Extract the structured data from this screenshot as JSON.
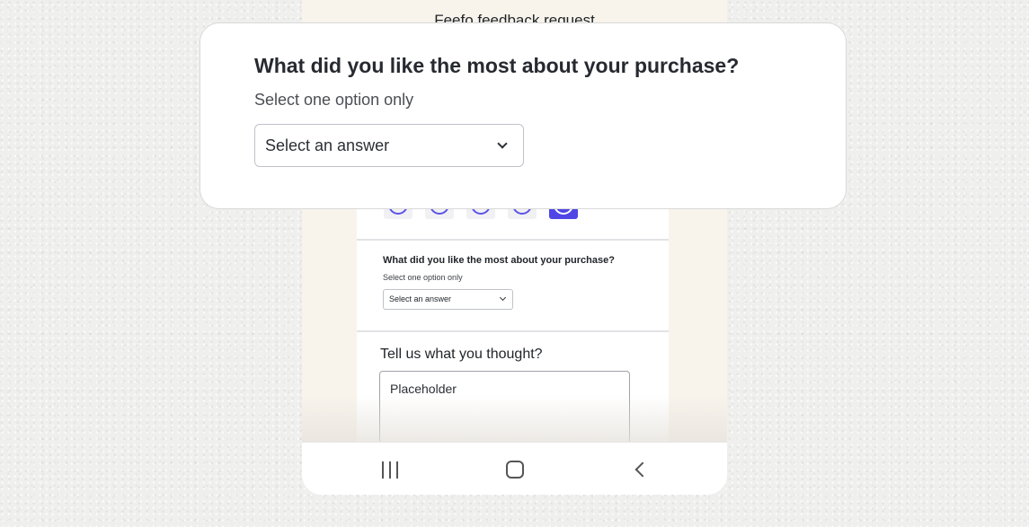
{
  "phone": {
    "title": "Feefo feedback request",
    "rating": {
      "selected_index": 4,
      "options": 5,
      "icon": "smiley-face-icon",
      "accent": "#4f46e5"
    },
    "mini_question": {
      "title": "What did you like the most about your purchase?",
      "subtitle": "Select one option only",
      "select_value": "Select an answer"
    },
    "comment": {
      "title": "Tell us what you thought?",
      "placeholder": "Placeholder"
    },
    "navbar": {
      "recents_icon": "recents-icon",
      "home_icon": "home-icon",
      "back_icon": "back-icon"
    }
  },
  "card": {
    "question": "What did you like the most about your purchase?",
    "subtitle": "Select one option only",
    "select_value": "Select an answer"
  }
}
